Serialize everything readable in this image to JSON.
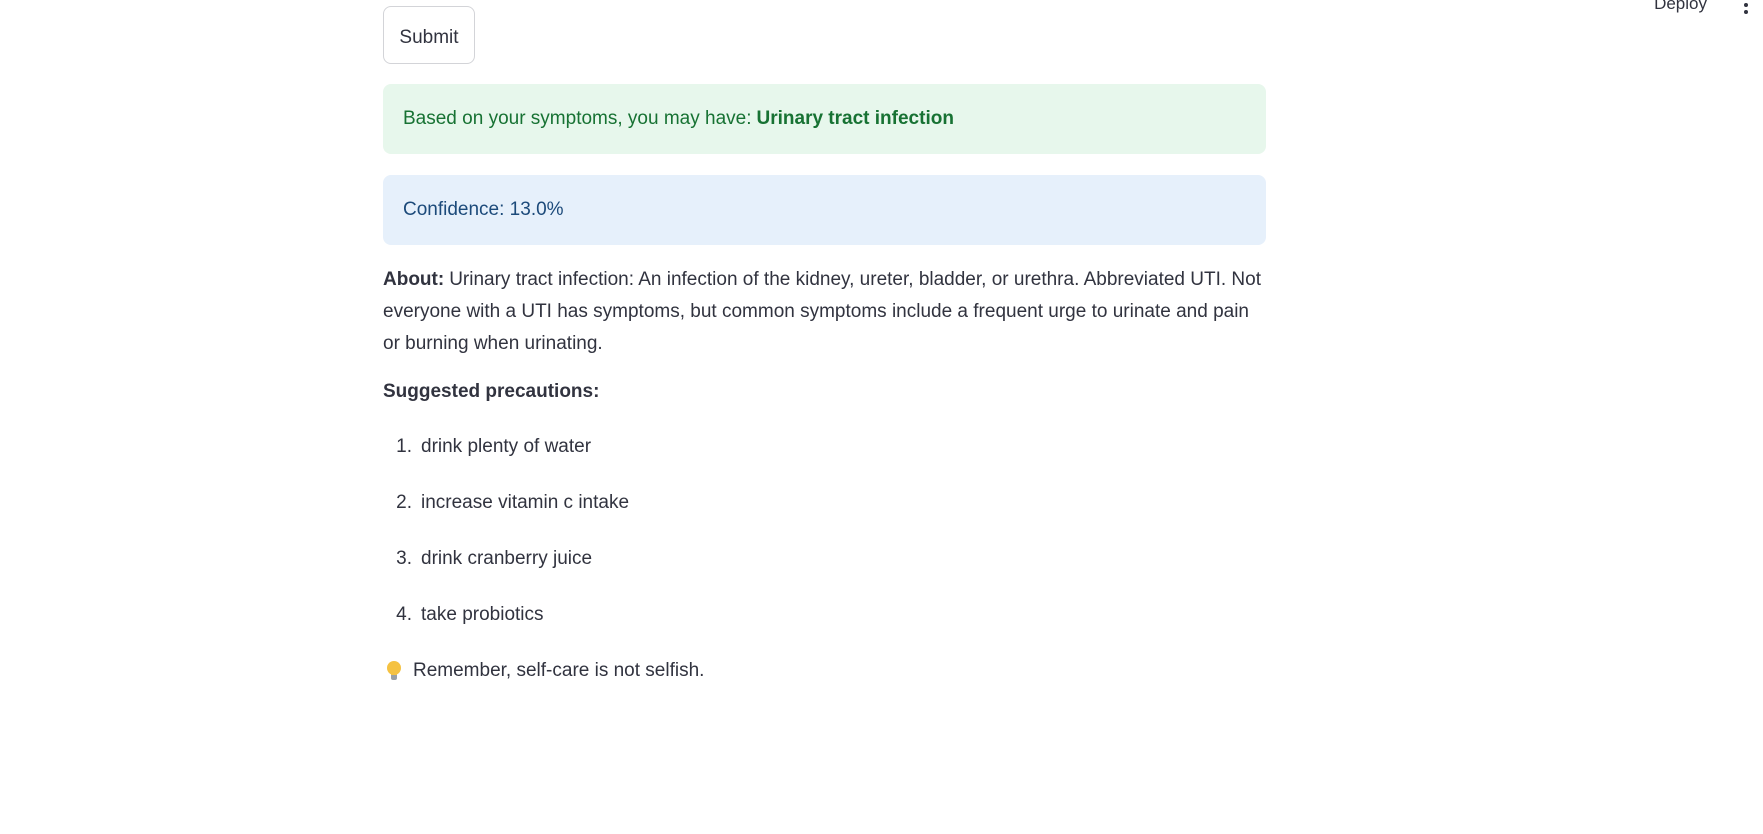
{
  "header": {
    "deploy_label": "Deploy",
    "menu_icon": "more-vertical-icon"
  },
  "form": {
    "submit_label": "Submit"
  },
  "result": {
    "prediction_prefix": "Based on your symptoms, you may have:",
    "prediction_value": "Urinary tract infection",
    "confidence_text": "Confidence: 13.0%",
    "success_color": "#177233",
    "info_color": "#1c4a7a"
  },
  "about": {
    "label": "About:",
    "text": "Urinary tract infection: An infection of the kidney, ureter, bladder, or urethra. Abbreviated UTI. Not everyone with a UTI has symptoms, but common symptoms include a frequent urge to urinate and pain or burning when urinating."
  },
  "precautions": {
    "title": "Suggested precautions:",
    "items": [
      {
        "num": "1.",
        "text": "drink plenty of water"
      },
      {
        "num": "2.",
        "text": "increase vitamin c intake"
      },
      {
        "num": "3.",
        "text": "drink cranberry juice"
      },
      {
        "num": "4.",
        "text": "take probiotics"
      }
    ]
  },
  "tip": {
    "icon": "lightbulb-icon",
    "text": "Remember, self-care is not selfish."
  }
}
